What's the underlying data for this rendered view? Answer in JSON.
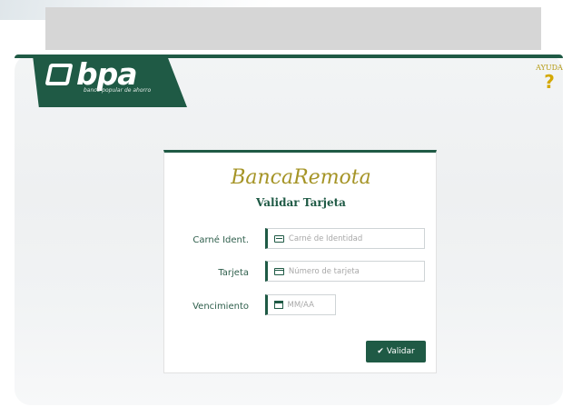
{
  "header": {
    "logo_text": "bpa",
    "logo_tagline": "banco popular de ahorro",
    "help_label": "AYUDA",
    "help_symbol": "?"
  },
  "form": {
    "title": "BancaRemota",
    "subtitle": "Validar Tarjeta",
    "fields": [
      {
        "label": "Carné Ident.",
        "placeholder": "Carné de Identidad",
        "value": "",
        "icon": "id-card-icon"
      },
      {
        "label": "Tarjeta",
        "placeholder": "Número de tarjeta",
        "value": "",
        "icon": "credit-card-icon"
      },
      {
        "label": "Vencimiento",
        "placeholder": "MM/AA",
        "value": "",
        "icon": "calendar-icon"
      }
    ],
    "submit_label": "Validar",
    "submit_icon": "check-icon"
  },
  "colors": {
    "brand_green": "#1f5a45",
    "title_gold": "#a59426",
    "help_yellow": "#d4a800"
  }
}
